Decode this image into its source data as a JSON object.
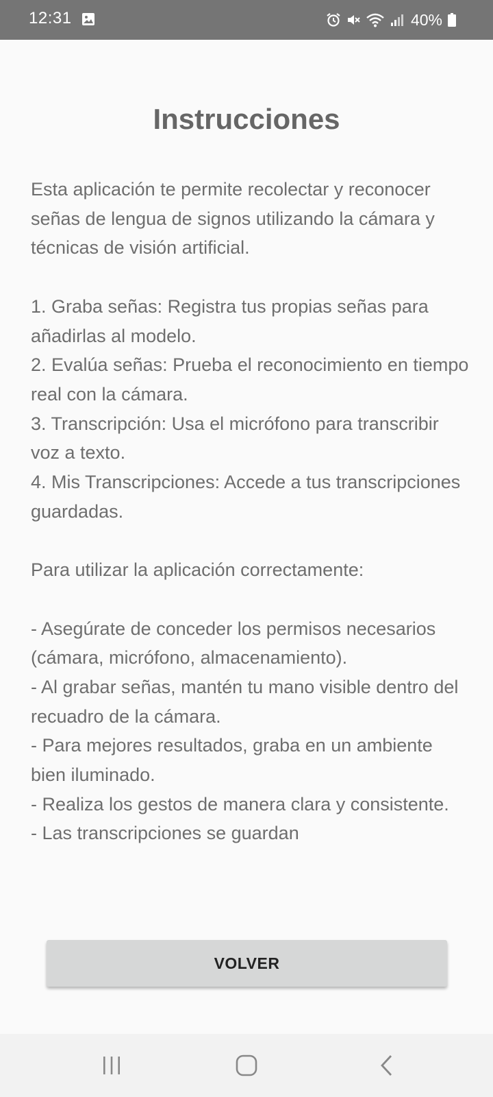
{
  "status_bar": {
    "time": "12:31",
    "battery_percent": "40%",
    "icons": [
      "gallery-icon",
      "alarm-icon",
      "mute-icon",
      "wifi-icon",
      "signal-icon",
      "battery-icon"
    ],
    "background_color": "#757575"
  },
  "page": {
    "title": "Instrucciones",
    "body_text": "Esta aplicación te permite recolectar y reconocer señas de lengua de signos utilizando la cámara y técnicas de visión artificial.\n\n1. Graba señas: Registra tus propias señas para añadirlas al modelo.\n2. Evalúa señas: Prueba el reconocimiento en tiempo real con la cámara.\n3. Transcripción: Usa el micrófono para transcribir voz a texto.\n4. Mis Transcripciones: Accede a tus transcripciones guardadas.\n\nPara utilizar la aplicación correctamente:\n\n- Asegúrate de conceder los permisos necesarios (cámara, micrófono, almacenamiento).\n- Al grabar señas, mantén tu mano visible dentro del recuadro de la cámara.\n- Para mejores resultados, graba en un ambiente bien iluminado.\n- Realiza los gestos de manera clara y consistente.\n- Las transcripciones se guardan"
  },
  "actions": {
    "back_label": "VOLVER"
  },
  "nav_bar": {
    "buttons": [
      "recents-icon",
      "home-icon",
      "back-icon"
    ]
  }
}
